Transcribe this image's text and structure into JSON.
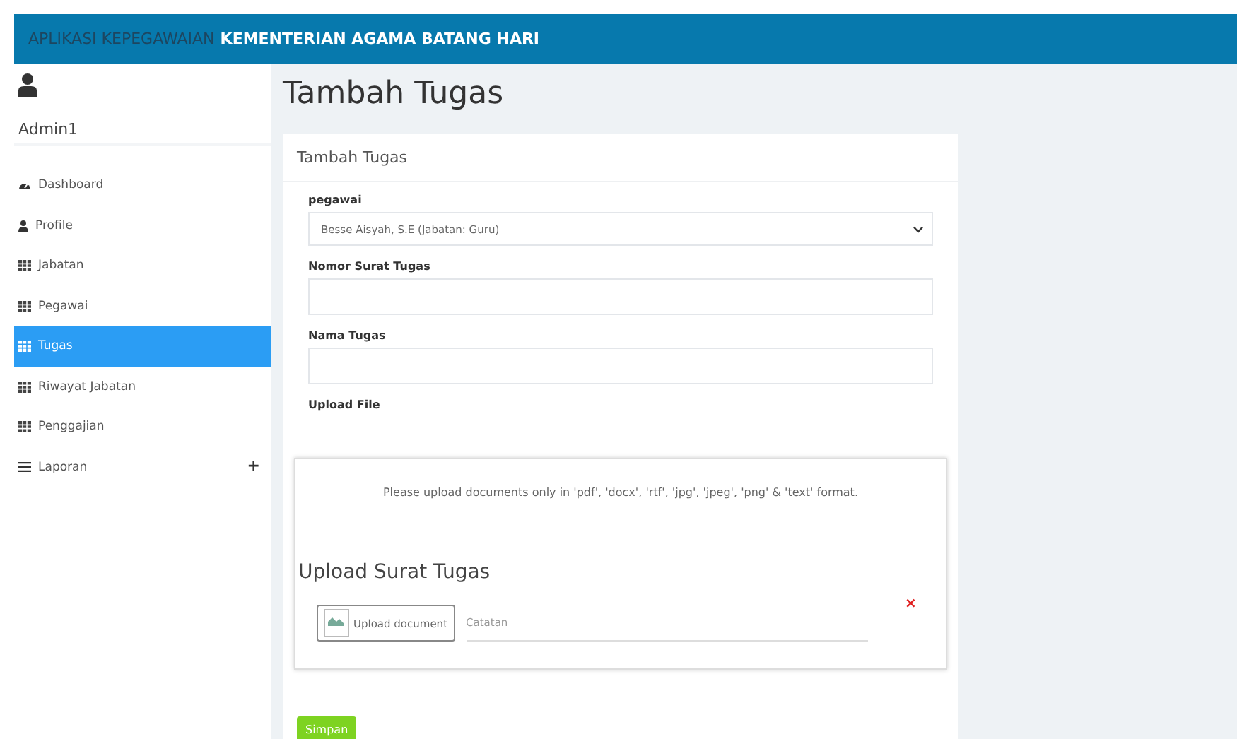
{
  "header": {
    "app_name": "APLIKASI KEPEGAWAIAN",
    "office_name": "KEMENTERIAN AGAMA BATANG HARI"
  },
  "sidebar": {
    "user": "Admin1",
    "items": [
      {
        "label": "Dashboard",
        "kind": "dashboard",
        "selected": false
      },
      {
        "label": "Profile",
        "kind": "profile",
        "selected": false
      },
      {
        "label": "Jabatan",
        "kind": "table",
        "selected": false
      },
      {
        "label": "Pegawai",
        "kind": "table",
        "selected": false
      },
      {
        "label": "Tugas",
        "kind": "table",
        "selected": true
      },
      {
        "label": "Riwayat Jabatan",
        "kind": "table",
        "selected": false
      },
      {
        "label": "Penggajian",
        "kind": "table",
        "selected": false
      },
      {
        "label": "Laporan",
        "kind": "menu",
        "selected": false,
        "expander": "+"
      }
    ]
  },
  "page_title": "Tambah Tugas",
  "form": {
    "title": "Tambah Tugas",
    "fields": [
      {
        "label": "pegawai",
        "kind": "select",
        "value": "Besse Aisyah, S.E (Jabatan: Guru)"
      },
      {
        "label": "Nomor Surat Tugas",
        "kind": "text"
      },
      {
        "label": "Nama Tugas",
        "kind": "text"
      },
      {
        "label": "Upload File",
        "kind": "upload"
      }
    ],
    "upload": {
      "notice": "Please upload documents only in 'pdf', 'docx', 'rtf', 'jpg', 'jpeg', 'png' & 'text' format.",
      "heading": "Upload Surat Tugas",
      "button": "Upload document",
      "note_placeholder": "Catatan",
      "remove": "×"
    },
    "submit": "Simpan"
  }
}
